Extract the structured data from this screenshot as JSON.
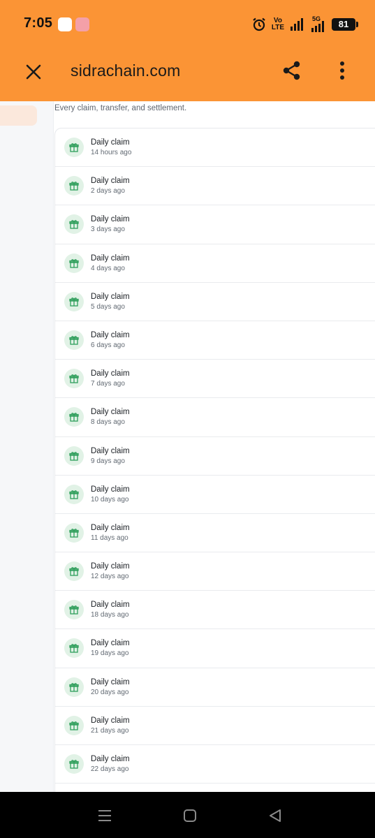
{
  "status_bar": {
    "time": "7:05",
    "network_label_top": "Vo",
    "network_label_bottom": "LTE",
    "signal_label": "5G",
    "battery": "81"
  },
  "browser": {
    "url": "sidrachain.com",
    "close_icon": "close-icon",
    "share_icon": "share-icon",
    "menu_icon": "more-vert-icon"
  },
  "page": {
    "subtitle": "Every claim, transfer, and settlement."
  },
  "activity": {
    "item_icon": "gift-icon",
    "items": [
      {
        "title": "Daily claim",
        "time": "14 hours ago"
      },
      {
        "title": "Daily claim",
        "time": "2 days ago"
      },
      {
        "title": "Daily claim",
        "time": "3 days ago"
      },
      {
        "title": "Daily claim",
        "time": "4 days ago"
      },
      {
        "title": "Daily claim",
        "time": "5 days ago"
      },
      {
        "title": "Daily claim",
        "time": "6 days ago"
      },
      {
        "title": "Daily claim",
        "time": "7 days ago"
      },
      {
        "title": "Daily claim",
        "time": "8 days ago"
      },
      {
        "title": "Daily claim",
        "time": "9 days ago"
      },
      {
        "title": "Daily claim",
        "time": "10 days ago"
      },
      {
        "title": "Daily claim",
        "time": "11 days ago"
      },
      {
        "title": "Daily claim",
        "time": "12 days ago"
      },
      {
        "title": "Daily claim",
        "time": "18 days ago"
      },
      {
        "title": "Daily claim",
        "time": "19 days ago"
      },
      {
        "title": "Daily claim",
        "time": "20 days ago"
      },
      {
        "title": "Daily claim",
        "time": "21 days ago"
      },
      {
        "title": "Daily claim",
        "time": "22 days ago"
      },
      {
        "title": "",
        "time": ""
      }
    ]
  },
  "colors": {
    "header": "#fb9435",
    "icon_bg": "#e1f2e6",
    "icon_fg": "#2e9e5b",
    "sidebar_active": "#fbe8dc"
  }
}
